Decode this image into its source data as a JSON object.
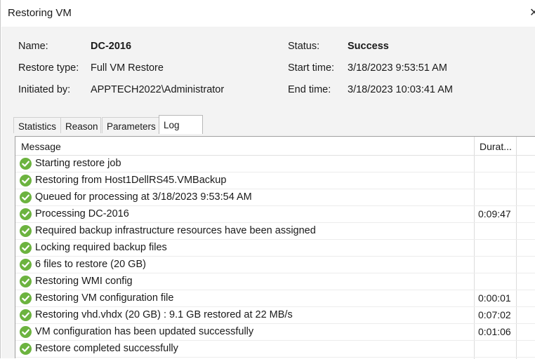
{
  "window": {
    "title": "Restoring VM"
  },
  "info": {
    "name_label": "Name:",
    "name_value": "DC-2016",
    "restore_type_label": "Restore type:",
    "restore_type_value": "Full VM Restore",
    "initiated_label": "Initiated by:",
    "initiated_value": "APPTECH2022\\Administrator",
    "status_label": "Status:",
    "status_value": "Success",
    "start_label": "Start time:",
    "start_value": "3/18/2023 9:53:51 AM",
    "end_label": "End time:",
    "end_value": "3/18/2023 10:03:41 AM"
  },
  "tabs": [
    "Statistics",
    "Reason",
    "Parameters",
    "Log"
  ],
  "log": {
    "columns": {
      "message": "Message",
      "duration": "Durat..."
    },
    "rows": [
      {
        "message": "Starting restore job",
        "duration": ""
      },
      {
        "message": "Restoring from Host1DellRS45.VMBackup",
        "duration": ""
      },
      {
        "message": "Queued for processing at 3/18/2023 9:53:54 AM",
        "duration": ""
      },
      {
        "message": "Processing DC-2016",
        "duration": "0:09:47"
      },
      {
        "message": "Required backup infrastructure resources have been assigned",
        "duration": ""
      },
      {
        "message": "Locking required backup files",
        "duration": ""
      },
      {
        "message": "6 files to restore (20 GB)",
        "duration": ""
      },
      {
        "message": "Restoring WMI config",
        "duration": ""
      },
      {
        "message": "Restoring VM configuration file",
        "duration": "0:00:01"
      },
      {
        "message": "Restoring vhd.vhdx (20 GB) : 9.1 GB restored at 22 MB/s",
        "duration": "0:07:02"
      },
      {
        "message": "VM configuration has been updated successfully",
        "duration": "0:01:06"
      },
      {
        "message": "Restore completed successfully",
        "duration": ""
      }
    ]
  },
  "colors": {
    "success_green": "#6cb33f",
    "background": "#f3f3f3"
  },
  "icons": {
    "row_status": "success-check-icon",
    "close": "close-icon"
  }
}
